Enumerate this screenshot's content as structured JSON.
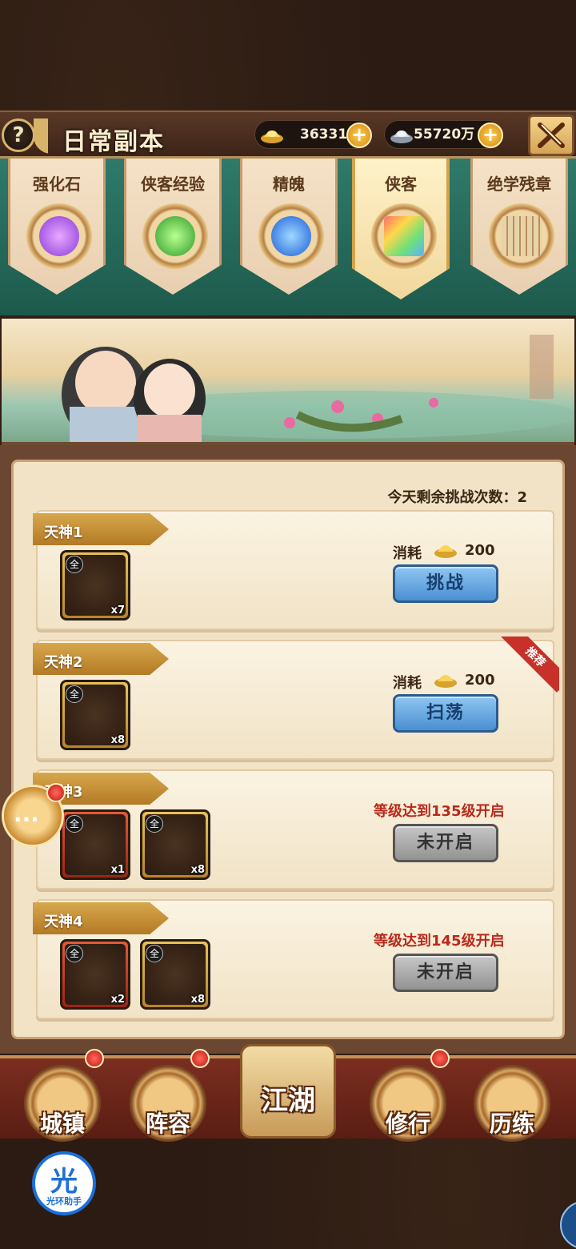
{
  "header": {
    "help_label": "?",
    "title": "日常副本",
    "gold_value": "36331",
    "silver_value": "55720万",
    "colors": {
      "gold": "#f0c040",
      "accent": "#d9b36a"
    }
  },
  "tabs": [
    {
      "label": "强化石",
      "icon": "purple-gem-icon",
      "active": false
    },
    {
      "label": "侠客经验",
      "icon": "exp-orb-icon",
      "active": false
    },
    {
      "label": "精魄",
      "icon": "blue-spirit-icon",
      "active": false
    },
    {
      "label": "侠客",
      "icon": "hero-token-icon",
      "active": true
    },
    {
      "label": "绝学残章",
      "icon": "scroll-pages-icon",
      "active": false
    }
  ],
  "panel": {
    "remaining_text": "今天剩余挑战次数：2"
  },
  "stages": [
    {
      "name": "天神1",
      "items": [
        {
          "tag": "全",
          "count": "x7",
          "rarity": "gold"
        }
      ],
      "cost_label": "消耗",
      "cost_value": "200",
      "button": "挑战",
      "button_style": "blue",
      "recommended": false
    },
    {
      "name": "天神2",
      "items": [
        {
          "tag": "全",
          "count": "x8",
          "rarity": "gold"
        }
      ],
      "cost_label": "消耗",
      "cost_value": "200",
      "button": "扫荡",
      "button_style": "blue",
      "recommended": true,
      "recommended_label": "推荐"
    },
    {
      "name": "天神3",
      "items": [
        {
          "tag": "全",
          "count": "x1",
          "rarity": "red"
        },
        {
          "tag": "全",
          "count": "x8",
          "rarity": "gold"
        }
      ],
      "requirement": "等级达到135级开启",
      "button": "未开启",
      "button_style": "gray"
    },
    {
      "name": "天神4",
      "items": [
        {
          "tag": "全",
          "count": "x2",
          "rarity": "red"
        },
        {
          "tag": "全",
          "count": "x8",
          "rarity": "gold"
        }
      ],
      "requirement": "等级达到145级开启",
      "button": "未开启",
      "button_style": "gray"
    }
  ],
  "chat": {
    "dots": "···"
  },
  "bottom_nav": [
    {
      "label": "城镇",
      "has_dot": true
    },
    {
      "label": "阵容",
      "has_dot": true
    },
    {
      "label": "江湖",
      "has_dot": false
    },
    {
      "label": "修行",
      "has_dot": true
    },
    {
      "label": "历练",
      "has_dot": false
    }
  ],
  "helper": {
    "glyph": "光",
    "label": "光环助手"
  }
}
